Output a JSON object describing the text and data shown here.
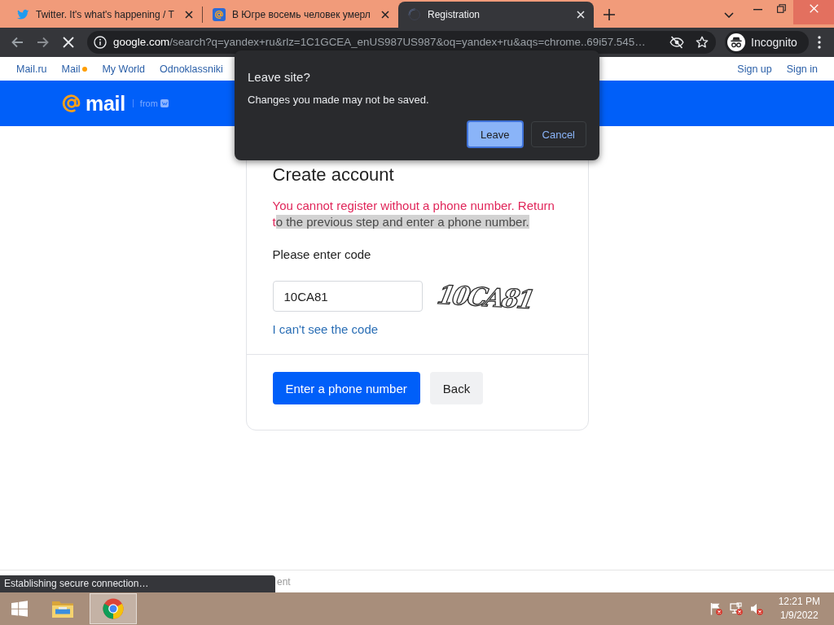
{
  "browser": {
    "tabs": [
      {
        "kind": "bird",
        "title": "Twitter. It's what's happening / T",
        "selected": false
      },
      {
        "kind": "at-sign",
        "title": "В Югре восемь человек умерл",
        "selected": false
      },
      {
        "kind": "spinner",
        "title": "Registration",
        "selected": true
      }
    ],
    "address": {
      "host": "google.com",
      "path": "/search?q=yandex+ru&rlz=1C1GCEA_enUS987US987&oq=yandex+ru&aqs=chrome..69i57.545…"
    },
    "profile_label": "Incognito"
  },
  "site_nav": {
    "links": [
      {
        "label": "Mail.ru",
        "dot": false
      },
      {
        "label": "Mail",
        "dot": true
      },
      {
        "label": "My World",
        "dot": false
      },
      {
        "label": "Odnoklassniki",
        "dot": false
      }
    ],
    "account_links": [
      "Sign up",
      "Sign in"
    ]
  },
  "header": {
    "logo_text": "mail",
    "from_label": "from"
  },
  "form": {
    "title": "Create account",
    "error": {
      "text": "You cannot register without a phone number. Return t",
      "highlighted": "o the previous step and enter a phone number."
    },
    "code_label": "Please enter code",
    "code_value": "10CA81",
    "captcha_text": "10CA81",
    "help_link": "I can't see the code",
    "buttons": [
      {
        "label": "Enter a phone number",
        "kind": "primary"
      },
      {
        "label": "Back",
        "kind": "secondary"
      }
    ]
  },
  "footer": {
    "text": "ent"
  },
  "status_bubble": "Establishing secure connection…",
  "dialog": {
    "title": "Leave site?",
    "message": "Changes you made may not be saved.",
    "buttons": [
      {
        "label": "Leave",
        "kind": "primary",
        "focused": true
      },
      {
        "label": "Cancel",
        "kind": "secondary",
        "focused": false
      }
    ]
  },
  "taskbar": {
    "apps": [
      {
        "kind": "folder",
        "selected": false
      },
      {
        "kind": "browser",
        "selected": true
      }
    ],
    "tray": [
      {
        "kind": "flag"
      },
      {
        "kind": "network"
      },
      {
        "kind": "speaker"
      }
    ],
    "time": "12:21 PM",
    "date": "1/9/2022"
  }
}
